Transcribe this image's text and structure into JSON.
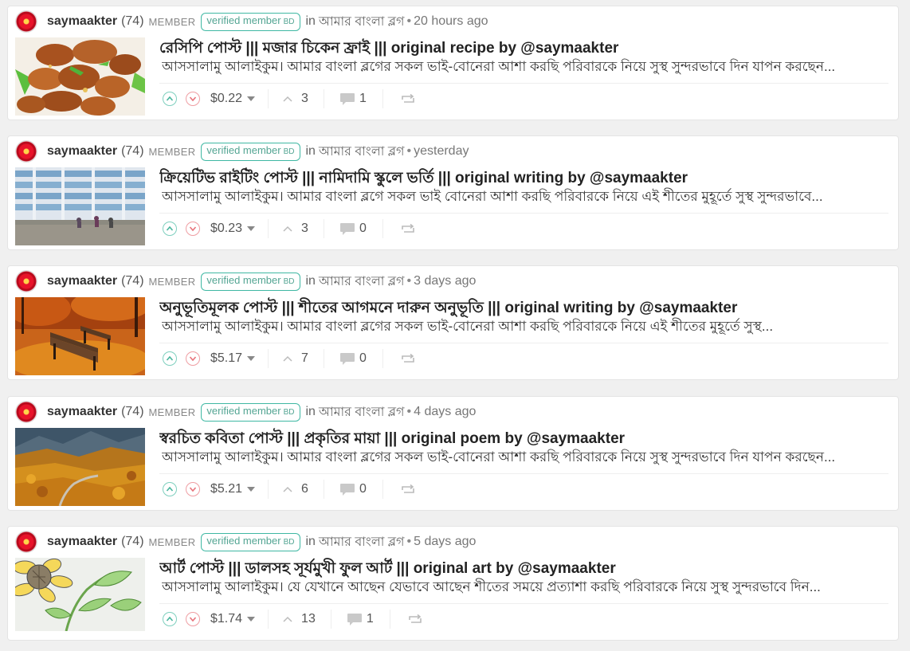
{
  "posts": [
    {
      "author": "saymaakter",
      "reputation": "(74)",
      "role": "MEMBER",
      "badge": "verified member",
      "badge_suffix": "BD",
      "in_label": "in",
      "community": "আমার বাংলা ব্লগ",
      "time": "20 hours ago",
      "title": "রেসিপি পোস্ট ||| মজার চিকেন ফ্রাই ||| original recipe by @saymaakter",
      "excerpt": "আসসালামু আলাইকুম। আমার বাংলা ব্লগের সকল ভাই-বোনেরা আশা করছি পরিবারকে নিয়ে সুস্থ সুন্দরভাবে দিন যাপন করছেন...",
      "payout": "$0.22",
      "votes": "3",
      "comments": "1",
      "image": "fried-chicken"
    },
    {
      "author": "saymaakter",
      "reputation": "(74)",
      "role": "MEMBER",
      "badge": "verified member",
      "badge_suffix": "BD",
      "in_label": "in",
      "community": "আমার বাংলা ব্লগ",
      "time": "yesterday",
      "title": "ক্রিয়েটিভ রাইটিং পোস্ট ||| নামিদামি স্কুলে ভর্তি ||| original writing by @saymaakter",
      "excerpt": "আসসালামু আলাইকুম। আমার বাংলা ব্লগে সকল ভাই বোনেরা আশা করছি পরিবারকে নিয়ে এই শীতের মুহূর্তে সুস্থ সুন্দরভাবে...",
      "payout": "$0.23",
      "votes": "3",
      "comments": "0",
      "image": "school-building"
    },
    {
      "author": "saymaakter",
      "reputation": "(74)",
      "role": "MEMBER",
      "badge": "verified member",
      "badge_suffix": "BD",
      "in_label": "in",
      "community": "আমার বাংলা ব্লগ",
      "time": "3 days ago",
      "title": "অনুভূতিমূলক পোস্ট ||| শীতের আগমনে দারুন অনুভূতি ||| original writing by @saymaakter",
      "excerpt": "  আসসালামু আলাইকুম। আমার বাংলা ব্লগের সকল ভাই-বোনেরা আশা করছি পরিবারকে নিয়ে এই শীতের মুহূর্তে সুস্থ...",
      "payout": "$5.17",
      "votes": "7",
      "comments": "0",
      "image": "autumn-bench"
    },
    {
      "author": "saymaakter",
      "reputation": "(74)",
      "role": "MEMBER",
      "badge": "verified member",
      "badge_suffix": "BD",
      "in_label": "in",
      "community": "আমার বাংলা ব্লগ",
      "time": "4 days ago",
      "title": "স্বরচিত কবিতা পোস্ট ||| প্রকৃতির মায়া ||| original poem by @saymaakter",
      "excerpt": "আসসালামু আলাইকুম। আমার বাংলা ব্লগের সকল ভাই-বোনেরা আশা করছি পরিবারকে নিয়ে সুস্থ সুন্দরভাবে দিন যাপন করছেন...",
      "payout": "$5.21",
      "votes": "6",
      "comments": "0",
      "image": "autumn-valley"
    },
    {
      "author": "saymaakter",
      "reputation": "(74)",
      "role": "MEMBER",
      "badge": "verified member",
      "badge_suffix": "BD",
      "in_label": "in",
      "community": "আমার বাংলা ব্লগ",
      "time": "5 days ago",
      "title": "আর্ট পোস্ট ||| ডালসহ সূর্যমুখী ফুল আর্ট ||| original art by @saymaakter",
      "excerpt": "আসসালামু আলাইকুম। যে যেখানে আছেন যেভাবে আছেন শীতের সময়ে প্রত্যাশা করছি পরিবারকে নিয়ে সুস্থ সুন্দরভাবে দিন...",
      "payout": "$1.74",
      "votes": "13",
      "comments": "1",
      "image": "sunflower-drawing"
    }
  ],
  "icons": {
    "upvote": "upvote-icon",
    "downvote": "downvote-icon",
    "voters": "chevron-up-icon",
    "comments": "comment-icon",
    "reblog": "reblog-icon",
    "payout_menu": "caret-down-icon"
  },
  "colors": {
    "upvote": "#7ecfbe",
    "downvote": "#ef9ea3",
    "badge": "#3fb8a3",
    "avatar": "#e8132a"
  }
}
